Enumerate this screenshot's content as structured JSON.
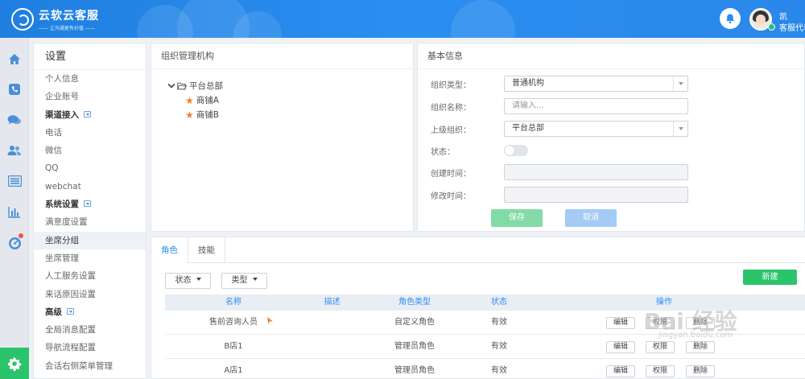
{
  "header": {
    "logo_title": "云软云客服",
    "logo_sub": "—— 让沟通更有价值 ——",
    "user_name": "凯",
    "user_role": "客服代表"
  },
  "rail": {
    "items": [
      "home-icon",
      "phone-icon",
      "chat-icon",
      "users-icon",
      "list-icon",
      "bar-chart-icon",
      "dashboard-icon"
    ],
    "bottom": "gear-icon"
  },
  "nav": {
    "title": "设置",
    "items": [
      {
        "label": "个人信息"
      },
      {
        "label": "企业账号"
      },
      {
        "label": "渠道接入"
      },
      {
        "label": "电话"
      },
      {
        "label": "微信"
      },
      {
        "label": "QQ"
      },
      {
        "label": "webchat"
      },
      {
        "label": "系统设置"
      },
      {
        "label": "满意度设置"
      },
      {
        "label": "坐席分组"
      },
      {
        "label": "坐席管理"
      },
      {
        "label": "人工服务设置"
      },
      {
        "label": "来话原因设置"
      },
      {
        "label": "高级"
      },
      {
        "label": "全局消息配置"
      },
      {
        "label": "导航流程配置"
      },
      {
        "label": "会话右侧菜单管理"
      }
    ]
  },
  "org_panel": {
    "title": "组织管理机构",
    "root": "平台总部",
    "children": [
      "商铺A",
      "商铺B"
    ]
  },
  "info_panel": {
    "title": "基本信息",
    "type_label": "组织类型：",
    "type_value": "普通机构",
    "name_label": "组织名称：",
    "name_placeholder": "请输入...",
    "parent_label": "上级组织：",
    "parent_value": "平台总部",
    "status_label": "状态：",
    "created_label": "创建时间：",
    "modified_label": "修改时间：",
    "save_label": "保存",
    "cancel_label": "取消"
  },
  "role_panel": {
    "tabs": [
      "角色",
      "技能"
    ],
    "status_filter": "状态",
    "type_filter": "类型",
    "new_label": "新建",
    "columns": [
      "名称",
      "描述",
      "角色类型",
      "状态",
      "操作"
    ],
    "rows": [
      {
        "name": "售前咨询人员",
        "desc": "",
        "role_type": "自定义角色",
        "status": "有效"
      },
      {
        "name": "B店1",
        "desc": "",
        "role_type": "管理员角色",
        "status": "有效"
      },
      {
        "name": "A店1",
        "desc": "",
        "role_type": "管理员角色",
        "status": "有效"
      }
    ],
    "edit_label": "编辑",
    "perm_label": "权限",
    "delete_label": "删除"
  },
  "watermark": {
    "text": "Bai 经验",
    "sub": "jingyan.baidu.com"
  },
  "colors": {
    "brand": "#2a8ef0",
    "green": "#2cc46b",
    "orange": "#f08030"
  }
}
